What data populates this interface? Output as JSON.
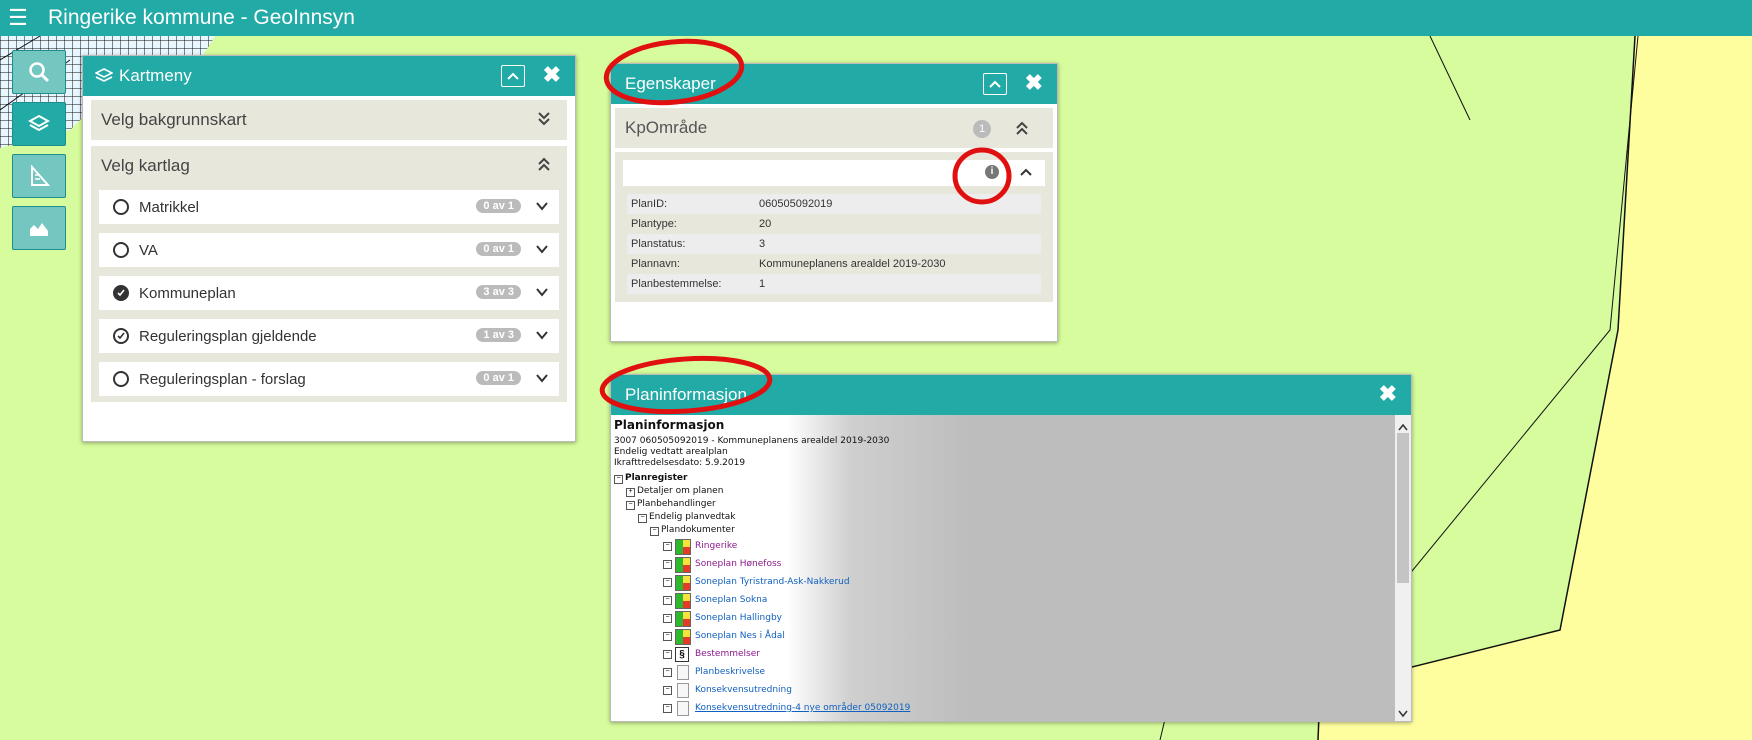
{
  "app": {
    "title": "Ringerike kommune - GeoInnsyn"
  },
  "toolbar": {
    "items": [
      "search-icon",
      "layers-icon",
      "measure-icon",
      "profile-icon"
    ]
  },
  "kartmeny": {
    "title": "Kartmeny",
    "background_section": "Velg bakgrunnskart",
    "layers_section": "Velg kartlag",
    "layers": [
      {
        "label": "Matrikkel",
        "count": "0 av 1",
        "state": "empty"
      },
      {
        "label": "VA",
        "count": "0 av 1",
        "state": "empty"
      },
      {
        "label": "Kommuneplan",
        "count": "3 av 3",
        "state": "full"
      },
      {
        "label": "Reguleringsplan gjeldende",
        "count": "1 av 3",
        "state": "partial"
      },
      {
        "label": "Reguleringsplan - forslag",
        "count": "0 av 1",
        "state": "empty"
      }
    ]
  },
  "egenskaper": {
    "title": "Egenskaper",
    "object_name": "KpOmråde",
    "object_count": "1",
    "properties": [
      {
        "key": "PlanID:",
        "value": "060505092019"
      },
      {
        "key": "Plantype:",
        "value": "20"
      },
      {
        "key": "Planstatus:",
        "value": "3"
      },
      {
        "key": "Plannavn:",
        "value": "Kommuneplanens arealdel 2019-2030"
      },
      {
        "key": "Planbestemmelse:",
        "value": "1"
      }
    ]
  },
  "planinfo": {
    "title": "Planinformasjon",
    "heading": "Planinformasjon",
    "line1": "3007 060505092019 - Kommuneplanens arealdel 2019-2030",
    "line2": "Endelig vedtatt arealplan",
    "line3": "Ikrafttredelsesdato: 5.9.2019",
    "tree": {
      "register": "Planregister",
      "details": "Detaljer om planen",
      "handlinger": "Planbehandlinger",
      "vedtak": "Endelig planvedtak",
      "dokumenter": "Plandokumenter"
    },
    "documents": [
      {
        "label": "Ringerike",
        "icon": "map",
        "color": "purple"
      },
      {
        "label": "Soneplan Hønefoss",
        "icon": "map",
        "color": "purple"
      },
      {
        "label": "Soneplan Tyristrand-Ask-Nakkerud",
        "icon": "map",
        "color": "blue"
      },
      {
        "label": "Soneplan Sokna",
        "icon": "map",
        "color": "blue"
      },
      {
        "label": "Soneplan Hallingby",
        "icon": "map",
        "color": "blue"
      },
      {
        "label": "Soneplan Nes i Ådal",
        "icon": "map",
        "color": "blue"
      },
      {
        "label": "Bestemmelser",
        "icon": "section",
        "color": "purple"
      },
      {
        "label": "Planbeskrivelse",
        "icon": "doc",
        "color": "blue"
      },
      {
        "label": "Konsekvensutredning",
        "icon": "doc",
        "color": "blue"
      },
      {
        "label": "Konsekvensutredning-4 nye områder 05092019",
        "icon": "doc",
        "color": "blue"
      }
    ]
  },
  "colors": {
    "accent": "#21aaa6",
    "map_green": "#d6fc9d",
    "map_yellow": "#fffe9f",
    "annotation_red": "#e01010"
  }
}
